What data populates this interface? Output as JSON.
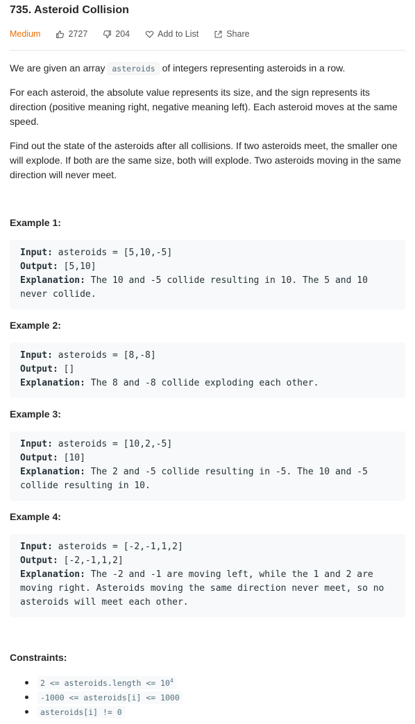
{
  "problem": {
    "title": "735. Asteroid Collision",
    "difficulty": "Medium",
    "likes": "2727",
    "dislikes": "204",
    "add_to_list": "Add to List",
    "share": "Share"
  },
  "description": {
    "p1_before": "We are given an array ",
    "p1_code": "asteroids",
    "p1_after": " of integers representing asteroids in a row.",
    "p2": "For each asteroid, the absolute value represents its size, and the sign represents its direction (positive meaning right, negative meaning left). Each asteroid moves at the same speed.",
    "p3": "Find out the state of the asteroids after all collisions. If two asteroids meet, the smaller one will explode. If both are the same size, both will explode. Two asteroids moving in the same direction will never meet."
  },
  "examples": [
    {
      "title": "Example 1:",
      "input_label": "Input:",
      "input": " asteroids = [5,10,-5]",
      "output_label": "Output:",
      "output": " [5,10]",
      "explanation_label": "Explanation:",
      "explanation": " The 10 and -5 collide resulting in 10. The 5 and 10 never collide."
    },
    {
      "title": "Example 2:",
      "input_label": "Input:",
      "input": " asteroids = [8,-8]",
      "output_label": "Output:",
      "output": " []",
      "explanation_label": "Explanation:",
      "explanation": " The 8 and -8 collide exploding each other."
    },
    {
      "title": "Example 3:",
      "input_label": "Input:",
      "input": " asteroids = [10,2,-5]",
      "output_label": "Output:",
      "output": " [10]",
      "explanation_label": "Explanation:",
      "explanation": " The 2 and -5 collide resulting in -5. The 10 and -5 collide resulting in 10."
    },
    {
      "title": "Example 4:",
      "input_label": "Input:",
      "input": " asteroids = [-2,-1,1,2]",
      "output_label": "Output:",
      "output": " [-2,-1,1,2]",
      "explanation_label": "Explanation:",
      "explanation": " The -2 and -1 are moving left, while the 1 and 2 are moving right. Asteroids moving the same direction never meet, so no asteroids will meet each other."
    }
  ],
  "constraints": {
    "title": "Constraints:",
    "c1_base": "2 <= asteroids.length <= 10",
    "c1_sup": "4",
    "c2": "-1000 <= asteroids[i] <= 1000",
    "c3": "asteroids[i] != 0"
  }
}
